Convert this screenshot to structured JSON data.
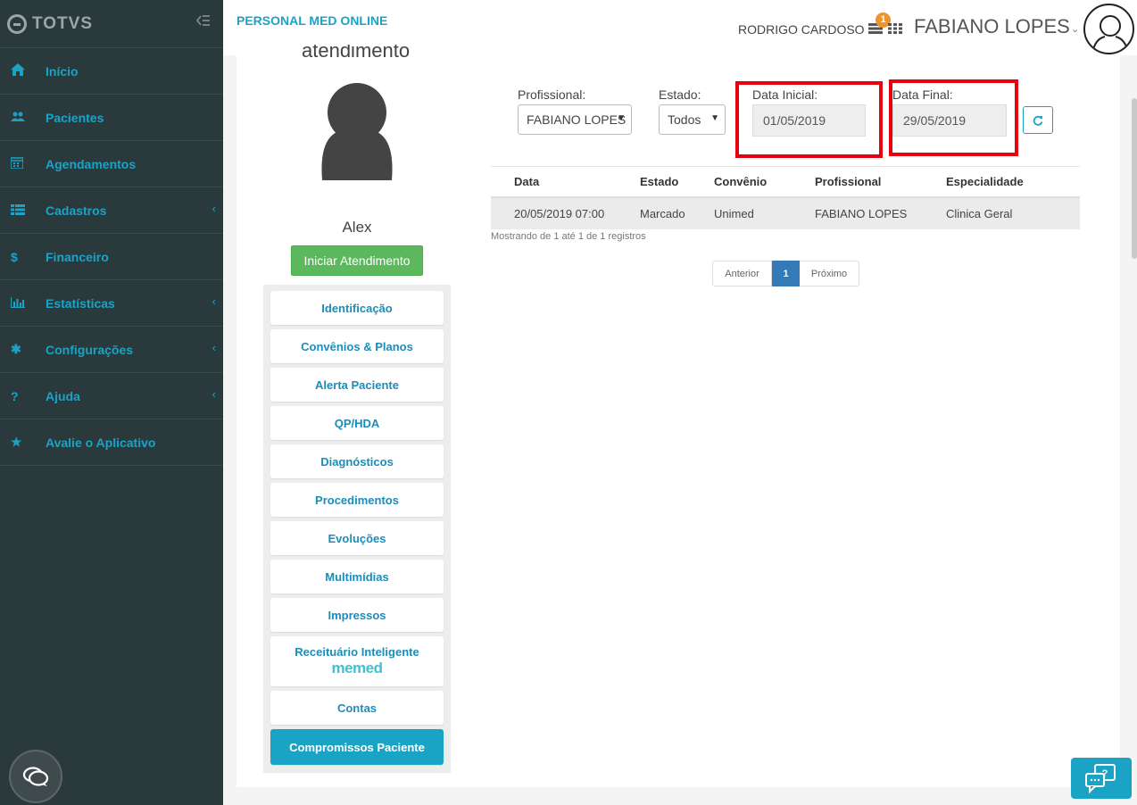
{
  "sidebar": {
    "brand": "TOTVS",
    "items": [
      {
        "label": "Início"
      },
      {
        "label": "Pacientes"
      },
      {
        "label": "Agendamentos"
      },
      {
        "label": "Cadastros"
      },
      {
        "label": "Financeiro"
      },
      {
        "label": "Estatísticas"
      },
      {
        "label": "Configurações"
      },
      {
        "label": "Ajuda"
      },
      {
        "label": "Avalie o Aplicativo"
      }
    ]
  },
  "header": {
    "app_title": "PERSONAL MED ONLINE",
    "user_secondary": "RODRIGO CARDOSO",
    "notification_count": "1",
    "user_primary": "FABIANO LOPES"
  },
  "patient": {
    "title": "atendimento",
    "name": "Alex",
    "start_button": "Iniciar Atendimento",
    "menu": [
      "Identificação",
      "Convênios & Planos",
      "Alerta Paciente",
      "QP/HDA",
      "Diagnósticos",
      "Procedimentos",
      "Evoluções",
      "Multimídias",
      "Impressos",
      "Receituário Inteligente",
      "Contas",
      "Compromissos Paciente"
    ],
    "memed_logo": "memed"
  },
  "filters": {
    "profissional_label": "Profissional:",
    "profissional_value": "FABIANO LOPES",
    "estado_label": "Estado:",
    "estado_value": "Todos",
    "data_inicial_label": "Data Inicial:",
    "data_inicial_value": "01/05/2019",
    "data_final_label": "Data Final:",
    "data_final_value": "29/05/2019"
  },
  "table": {
    "headers": [
      "Data",
      "Estado",
      "Convênio",
      "Profissional",
      "Especialidade"
    ],
    "rows": [
      [
        "20/05/2019 07:00",
        "Marcado",
        "Unimed",
        "FABIANO LOPES",
        "Clinica Geral"
      ]
    ],
    "info": "Mostrando de 1 até 1 de 1 registros"
  },
  "pagination": {
    "prev": "Anterior",
    "current": "1",
    "next": "Próximo"
  },
  "colors": {
    "accent": "#1ba3c6",
    "sidebar_bg": "#2a3a3c",
    "success": "#5cb85c",
    "highlight": "#e8000b",
    "badge": "#f0932b"
  }
}
